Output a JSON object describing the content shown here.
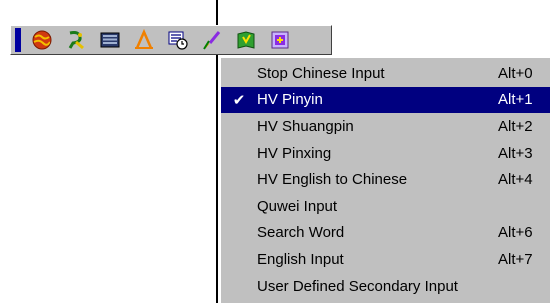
{
  "toolbar": {
    "buttons": [
      {
        "icon": "globe-icon"
      },
      {
        "icon": "writer-icon"
      },
      {
        "icon": "keyboard-icon"
      },
      {
        "icon": "font-a-icon"
      },
      {
        "icon": "translate-clock-icon"
      },
      {
        "icon": "brush-icon"
      },
      {
        "icon": "help-book-icon"
      },
      {
        "icon": "settings-icon"
      }
    ]
  },
  "menu": {
    "items": [
      {
        "label": "Stop Chinese Input",
        "shortcut": "Alt+0",
        "checked": ""
      },
      {
        "label": "HV Pinyin",
        "shortcut": "Alt+1",
        "checked": "✔"
      },
      {
        "label": "HV Shuangpin",
        "shortcut": "Alt+2",
        "checked": ""
      },
      {
        "label": "HV Pinxing",
        "shortcut": "Alt+3",
        "checked": ""
      },
      {
        "label": "HV English to Chinese",
        "shortcut": "Alt+4",
        "checked": ""
      },
      {
        "label": "Quwei Input",
        "shortcut": "",
        "checked": ""
      },
      {
        "label": "Search Word",
        "shortcut": "Alt+6",
        "checked": ""
      },
      {
        "label": "English Input",
        "shortcut": "Alt+7",
        "checked": ""
      },
      {
        "label": "User Defined Secondary Input",
        "shortcut": "",
        "checked": ""
      }
    ]
  }
}
